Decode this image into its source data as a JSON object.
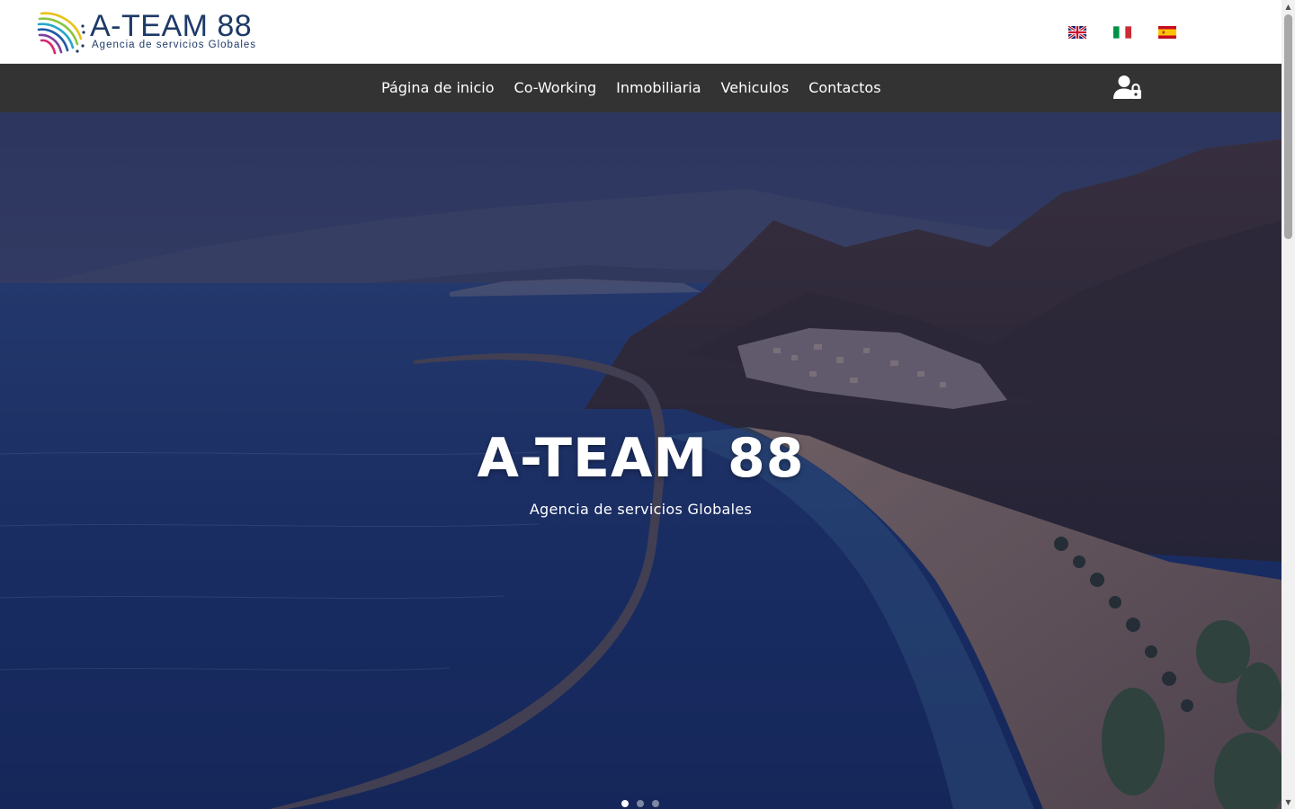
{
  "brand": {
    "name": "A-TEAM 88",
    "tagline": "Agencia de servicios Globales"
  },
  "languages": [
    {
      "code": "en",
      "label": "English",
      "flag": "uk-flag-icon"
    },
    {
      "code": "it",
      "label": "Italiano",
      "flag": "italy-flag-icon"
    },
    {
      "code": "es",
      "label": "Español",
      "flag": "spain-flag-icon",
      "active": true
    }
  ],
  "nav": {
    "items": [
      {
        "label": "Página de inicio"
      },
      {
        "label": "Co-Working"
      },
      {
        "label": "Inmobiliaria"
      },
      {
        "label": "Vehiculos"
      },
      {
        "label": "Contactos"
      }
    ],
    "account_icon": "user-lock-icon"
  },
  "hero": {
    "title": "A-TEAM 88",
    "subtitle": "Agencia de servicios Globales",
    "slides": 3,
    "active_slide": 1
  },
  "colors": {
    "navbar_bg": "#333333",
    "brand_blue": "#1e3a68",
    "text_white": "#ffffff"
  }
}
